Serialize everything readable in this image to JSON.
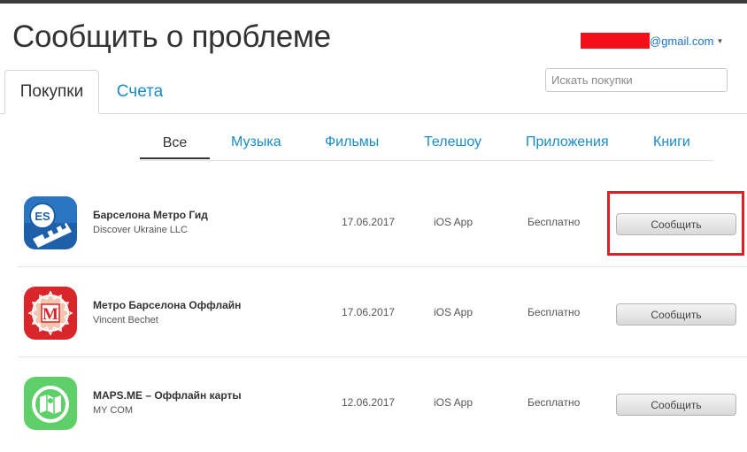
{
  "page": {
    "title": "Сообщить о проблеме",
    "account_email": "@gmail.com"
  },
  "tabs": [
    {
      "label": "Покупки",
      "active": true
    },
    {
      "label": "Счета",
      "active": false
    }
  ],
  "search": {
    "placeholder": "Искать покупки"
  },
  "filters": [
    "Все",
    "Музыка",
    "Фильмы",
    "Телешоу",
    "Приложения",
    "Книги"
  ],
  "purchases": [
    {
      "name": "Барселона Метро Гид",
      "developer": "Discover Ukraine LLC",
      "date": "17.06.2017",
      "type": "iOS App",
      "price": "Бесплатно",
      "action": "Сообщить",
      "icon": "metro-train-es-icon"
    },
    {
      "name": "Метро Барселона Оффлайн",
      "developer": "Vincent Bechet",
      "date": "17.06.2017",
      "type": "iOS App",
      "price": "Бесплатно",
      "action": "Сообщить",
      "icon": "metro-m-logo-icon"
    },
    {
      "name": "MAPS.ME – Оффлайн карты",
      "developer": "MY COM",
      "date": "12.06.2017",
      "type": "iOS App",
      "price": "Бесплатно",
      "action": "Сообщить",
      "icon": "map-pin-icon"
    }
  ],
  "colors": {
    "link": "#1a8cc4",
    "redaction": "#f30f17",
    "highlight": "#d8222a"
  }
}
